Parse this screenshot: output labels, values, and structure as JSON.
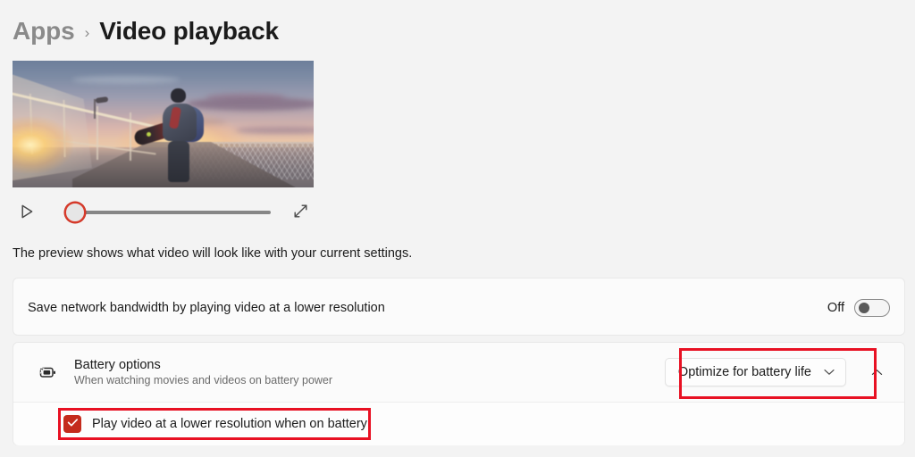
{
  "breadcrumb": {
    "parent": "Apps",
    "separator": "›",
    "current": "Video playback"
  },
  "preview": {
    "caption": "The preview shows what video will look like with your current settings.",
    "play_icon": "play-triangle-icon",
    "expand_icon": "fullscreen-expand-icon",
    "slider_position_percent": 0,
    "scene_description": "Person walking on a pier at sunset carrying a snowboard"
  },
  "settings": {
    "bandwidth": {
      "label": "Save network bandwidth by playing video at a lower resolution",
      "toggle_state_label": "Off",
      "toggle_on": false
    },
    "battery": {
      "icon": "battery-charging-icon",
      "title": "Battery options",
      "subtitle": "When watching movies and videos on battery power",
      "dropdown_value": "Optimize for battery life",
      "dropdown_chevron": "chevron-down-icon",
      "collapse_chevron": "chevron-up-icon",
      "expanded": true,
      "checkbox": {
        "label": "Play video at a lower resolution when on battery",
        "checked": true,
        "check_glyph": "checkmark-icon"
      }
    }
  },
  "colors": {
    "annotation_red": "#e81123",
    "accent_red": "#c42b1c",
    "page_background": "#f3f3f3",
    "card_background": "#fbfbfb"
  }
}
